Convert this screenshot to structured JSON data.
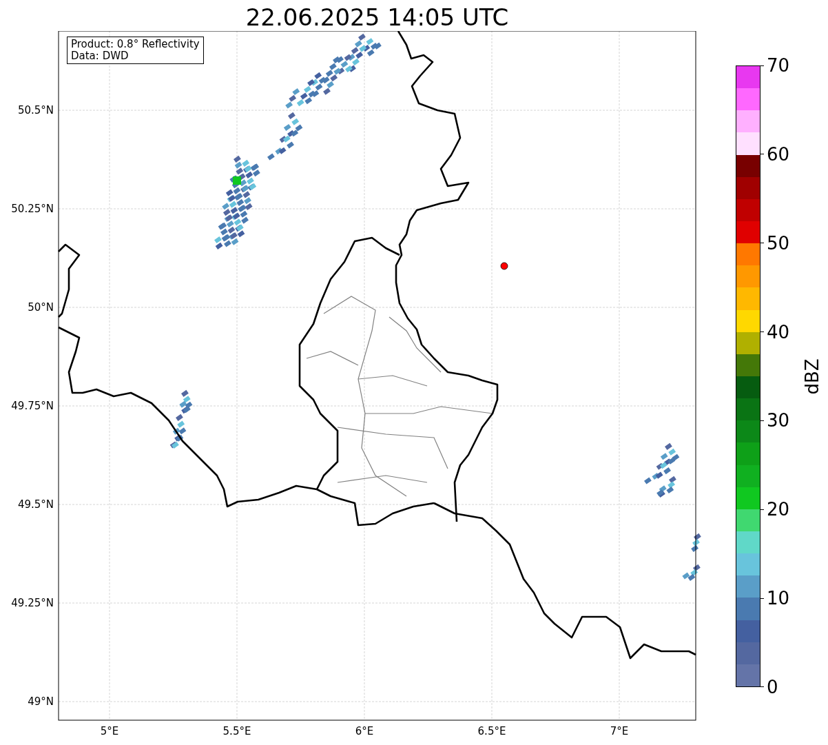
{
  "title": "22.06.2025 14:05 UTC",
  "info_box": [
    "Product: 0.8° Reflectivity",
    "Data: DWD"
  ],
  "map": {
    "lat_ticks": [
      "50.5°N",
      "50.25°N",
      "50°N",
      "49.75°N",
      "49.5°N",
      "49.25°N",
      "49°N"
    ],
    "lon_ticks": [
      "5°E",
      "5.5°E",
      "6°E",
      "6.5°E",
      "7°E"
    ]
  },
  "colorbar": {
    "label": "dBZ",
    "ticks": [
      "70",
      "60",
      "50",
      "40",
      "30",
      "20",
      "10",
      "0"
    ],
    "bins": [
      {
        "color": "#e838f0"
      },
      {
        "color": "#ff68ff"
      },
      {
        "color": "#ffb0ff"
      },
      {
        "color": "#ffe0ff"
      },
      {
        "color": "#780000"
      },
      {
        "color": "#a00000"
      },
      {
        "color": "#c00000"
      },
      {
        "color": "#e00000"
      },
      {
        "color": "#ff7800"
      },
      {
        "color": "#ff9800"
      },
      {
        "color": "#ffb800"
      },
      {
        "color": "#ffd800"
      },
      {
        "color": "#b0b000"
      },
      {
        "color": "#447808"
      },
      {
        "color": "#065c10"
      },
      {
        "color": "#0a7414"
      },
      {
        "color": "#0c8818"
      },
      {
        "color": "#0ea018"
      },
      {
        "color": "#10b020"
      },
      {
        "color": "#10c820"
      },
      {
        "color": "#40d870"
      },
      {
        "color": "#60d8c8"
      },
      {
        "color": "#68c4dc"
      },
      {
        "color": "#5a9ec8"
      },
      {
        "color": "#4a7ab0"
      },
      {
        "color": "#4460a0"
      },
      {
        "color": "#5468a0"
      },
      {
        "color": "#6474a8"
      }
    ]
  }
}
